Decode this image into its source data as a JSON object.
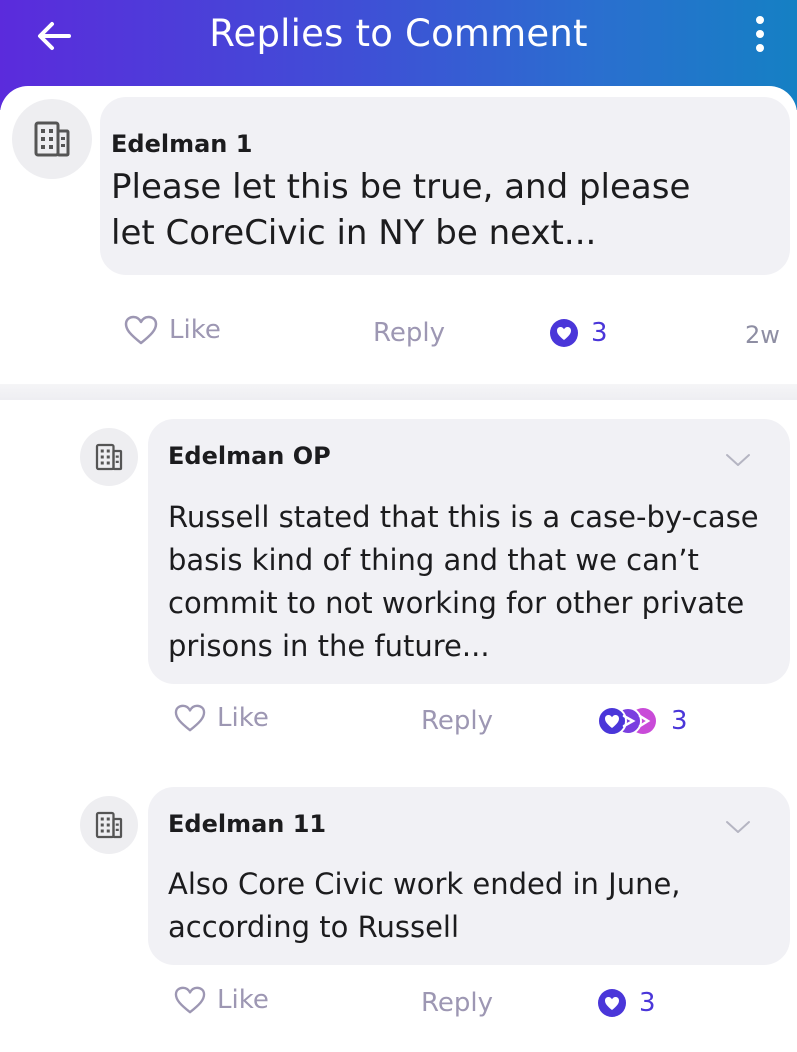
{
  "header": {
    "title": "Replies to Comment"
  },
  "parent_comment": {
    "author": "Edelman 1",
    "lines": [
      "Please let this be true, and please",
      "let CoreCivic in NY be next..."
    ],
    "like_label": "Like",
    "reply_label": "Reply",
    "reaction_count": "3",
    "timestamp": "2w"
  },
  "replies": [
    {
      "author": "Edelman OP",
      "lines": [
        "Russell stated that this is a case-by-case",
        "basis kind of thing and that we can’t",
        "commit to not working for other private",
        "prisons in the future..."
      ],
      "like_label": "Like",
      "reply_label": "Reply",
      "reaction_count": "3"
    },
    {
      "author": "Edelman 11",
      "lines": [
        "Also Core Civic work ended in June,",
        "according to Russell"
      ],
      "like_label": "Like",
      "reply_label": "Reply",
      "reaction_count": "3"
    }
  ],
  "colors": {
    "header_gradient_start": "#5b2bdc",
    "header_gradient_end": "#1580c4",
    "reaction_blue": "#4a36d9",
    "reaction_pink": "#c94bd8",
    "bubble_bg": "#f1f1f5",
    "muted_text": "#9d97b3"
  },
  "icons": {
    "back": "arrow-left-icon",
    "more": "more-vertical-icon",
    "avatar": "building-icon",
    "like": "heart-outline-icon",
    "reaction": "heart-filled-icon",
    "expand": "chevron-down-icon"
  }
}
